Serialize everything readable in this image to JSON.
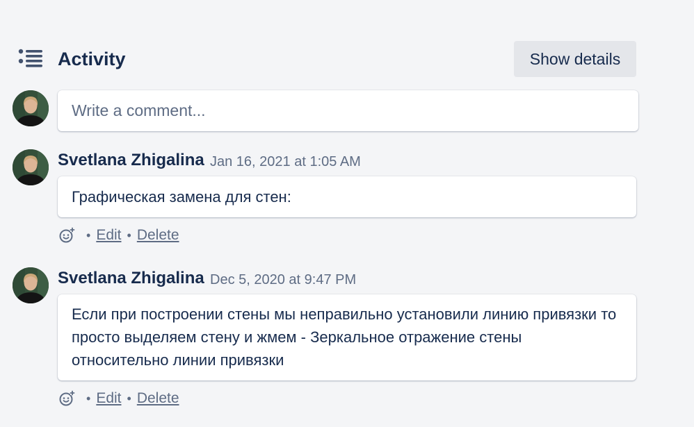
{
  "activity": {
    "title": "Activity",
    "show_details_label": "Show details",
    "icon": "activity-list-icon"
  },
  "new_comment": {
    "placeholder": "Write a comment..."
  },
  "comments": [
    {
      "author": "Svetlana Zhigalina",
      "timestamp": "Jan 16, 2021 at 1:05 AM",
      "text": "Графическая замена для стен:",
      "separator": "•",
      "edit_label": "Edit",
      "delete_label": "Delete"
    },
    {
      "author": "Svetlana Zhigalina",
      "timestamp": "Dec 5, 2020 at 9:47 PM",
      "text": "Если при построении стены мы неправильно установили линию привязки то просто выделяем стену и жмем - Зеркальное отражение стены относительно линии привязки",
      "separator": "•",
      "edit_label": "Edit",
      "delete_label": "Delete"
    }
  ]
}
